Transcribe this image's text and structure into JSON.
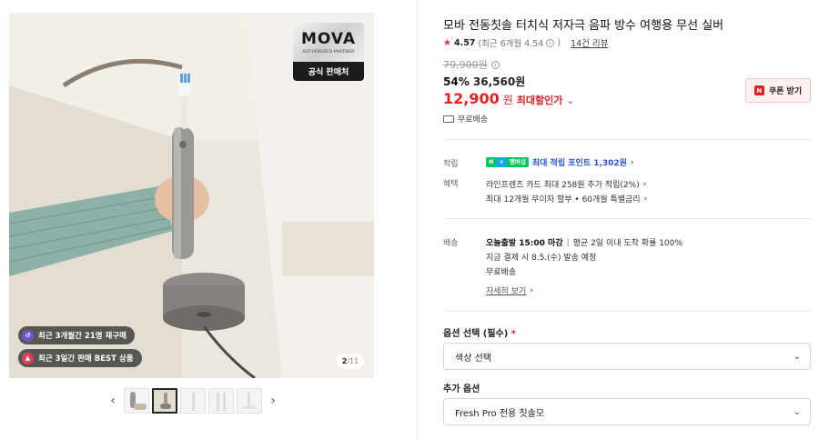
{
  "gallery": {
    "brand_logo": "MOVA",
    "brand_sub": "AUTHORIZED PARTNER",
    "official_badge": "공식 판매처",
    "pill_repurchase": "최근 3개월간 21명 재구매",
    "pill_best": "최근 3일간 판매 BEST 상품",
    "counter_current": "2",
    "counter_total": "/11",
    "prev_arrow": "‹",
    "next_arrow": "›"
  },
  "product": {
    "title": "모바 전동칫솔 터치식 저자극 음파 방수 여행용 무선 실버",
    "rating": "4.57",
    "rating_recent": "(최근 6개월 4.54",
    "review_link": "14건 리뷰",
    "original_price": "79,900원",
    "discount_rate": "54%",
    "discount_price": "36,560원",
    "final_price": "12,900",
    "final_won": "원",
    "max_label": "최대할인가",
    "coupon_button": "쿠폰 받기",
    "free_shipping": "무료배송"
  },
  "benefits": {
    "points_label": "적립",
    "npay_n": "N",
    "npay_plus": "+",
    "npay_m": "멤버십",
    "points_text": "최대 적립 포인트 1,302원",
    "benefit_label": "혜택",
    "card_text": "라인프렌즈 카드 최대 258원 추가 적립(2%)",
    "installment_text": "최대 12개월 무이자 할부 • 60개월 특별금리"
  },
  "delivery": {
    "label": "배송",
    "today_bold": "오늘출발 15:00 마감",
    "today_rest": "평균 2일 이내 도착 확률 100%",
    "ship_date": "지금 결제 시 8.5.(수) 발송 예정",
    "free": "무료배송",
    "details_link": "자세히 보기"
  },
  "options": {
    "required_label": "옵션 선택 (필수)",
    "required_mark": "*",
    "color_select": "색상 선택",
    "extra_label": "추가 옵션",
    "extra_select": "Fresh Pro 전용 칫솔모"
  },
  "colors": {
    "accent_red": "#e52222",
    "point_blue": "#2c54d8",
    "npay_green": "#03c75a"
  }
}
